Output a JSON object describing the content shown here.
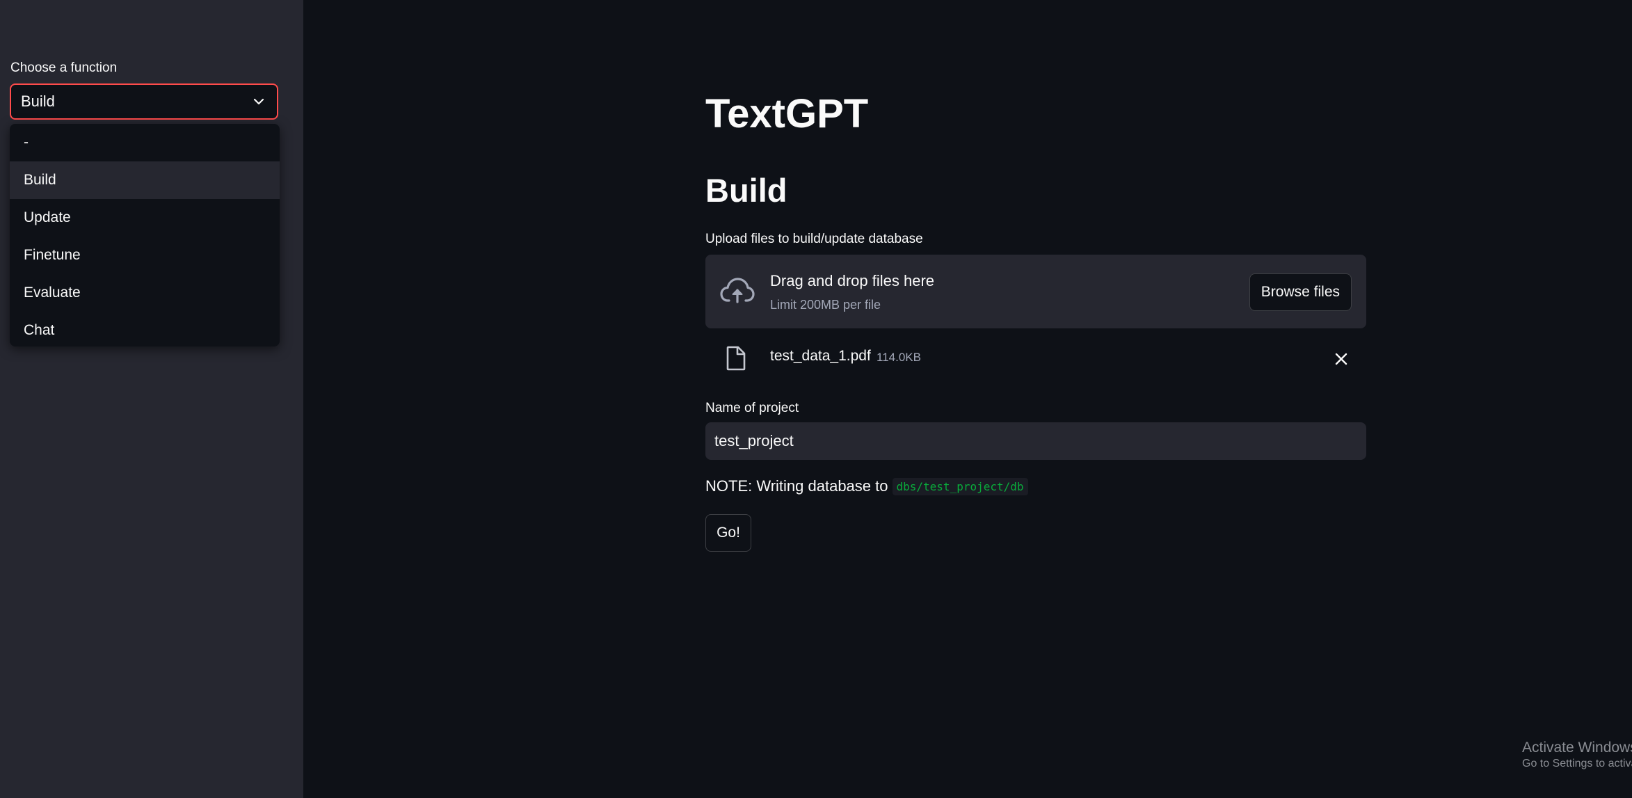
{
  "sidebar": {
    "select_label": "Choose a function",
    "selected_value": "Build",
    "options": [
      "-",
      "Build",
      "Update",
      "Finetune",
      "Evaluate",
      "Chat"
    ],
    "accent_color": "#ff4b4b"
  },
  "main": {
    "title": "TextGPT",
    "subtitle": "Build",
    "upload": {
      "label": "Upload files to build/update database",
      "drop_text": "Drag and drop files here",
      "limit_text": "Limit 200MB per file",
      "browse_label": "Browse files",
      "icon": "cloud-upload-icon"
    },
    "file": {
      "name": "test_data_1.pdf",
      "size": "114.0KB",
      "icon": "file-icon"
    },
    "project": {
      "label": "Name of project",
      "value": "test_project"
    },
    "note": {
      "text": "NOTE: Writing database to",
      "code": "dbs/test_project/db",
      "code_color": "#09ab3b"
    },
    "go_label": "Go!"
  },
  "watermark": {
    "title": "Activate Windows",
    "subtitle": "Go to Settings to activate Windows."
  }
}
